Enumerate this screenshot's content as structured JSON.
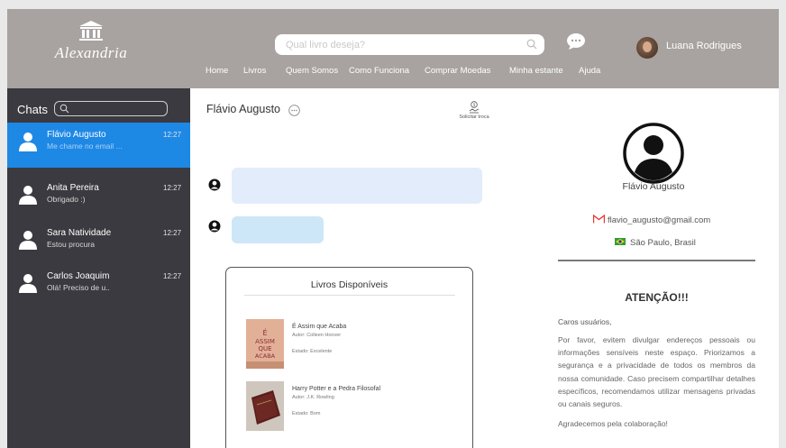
{
  "brand": {
    "name": "Alexandria",
    "logo_icon": "temple-icon"
  },
  "search": {
    "placeholder": "Qual livro deseja?",
    "icon": "search-icon"
  },
  "nav": [
    "Home",
    "Livros",
    "Quem Somos",
    "Como Funciona",
    "Comprar Moedas",
    "Minha estante",
    "Ajuda"
  ],
  "user": {
    "name": "Luana Rodrigues"
  },
  "sidebar": {
    "title": "Chats",
    "chats": [
      {
        "name": "Flávio Augusto",
        "preview": "Me chame no email ...",
        "time": "12:27",
        "active": true
      },
      {
        "name": "Anita Pereira",
        "preview": "Obrigado :)",
        "time": "12:27",
        "active": false
      },
      {
        "name": "Sara Natividade",
        "preview": "Estou procura",
        "time": "12:27",
        "active": false
      },
      {
        "name": "Carlos Joaquim",
        "preview": "Olá! Preciso de u..",
        "time": "12:27",
        "active": false
      }
    ]
  },
  "conversation": {
    "contact": "Flávio Augusto",
    "swap_label": "Solicitar troca"
  },
  "books": {
    "title": "Livros Disponíveis",
    "items": [
      {
        "title": "É Assim que Acaba",
        "author": "Autor: Colleen Hoover",
        "state": "Estado: Excelente"
      },
      {
        "title": "Harry Potter e a Pedra Filosofal",
        "author": "Autor: J.K. Rowling",
        "state": "Estado: Bom"
      }
    ]
  },
  "profile": {
    "name": "Flávio Augusto",
    "email": "flavio_augusto@gmail.com",
    "location": "São Paulo, Brasil"
  },
  "warning": {
    "title": "ATENÇÃO!!!",
    "greeting": "Caros usuários,",
    "body": "Por favor, evitem divulgar endereços pessoais ou informações sensíveis neste espaço. Priorizamos a segurança e a privacidade de todos os membros da nossa comunidade. Caso precisem compartilhar detalhes específicos, recomendamos utilizar mensagens privadas ou canais seguros.",
    "thanks": "Agradecemos pela colaboração!"
  },
  "colors": {
    "header": "#a8a3a0",
    "sidebar": "#3a3a40",
    "accent": "#1e88e5"
  }
}
